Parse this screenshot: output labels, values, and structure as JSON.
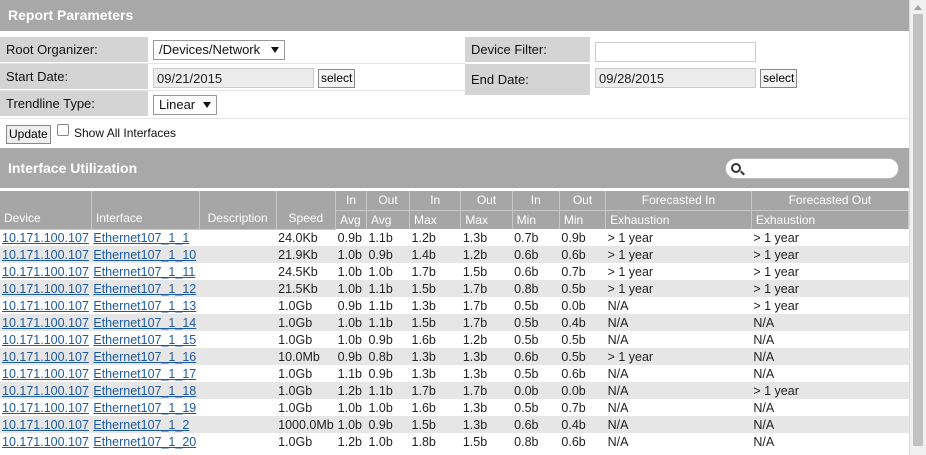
{
  "report_parameters": {
    "title": "Report Parameters",
    "root_organizer": {
      "label": "Root Organizer:",
      "value": "/Devices/Network"
    },
    "device_filter": {
      "label": "Device Filter:",
      "value": ""
    },
    "start_date": {
      "label": "Start Date:",
      "value": "09/21/2015",
      "select_label": "select"
    },
    "end_date": {
      "label": "End Date:",
      "value": "09/28/2015",
      "select_label": "select"
    },
    "trendline_type": {
      "label": "Trendline Type:",
      "value": "Linear"
    },
    "update_label": "Update",
    "show_all_label": "Show All Interfaces",
    "show_all_checked": false
  },
  "interface_utilization": {
    "title": "Interface Utilization",
    "search_value": "",
    "columns_top": [
      "Device",
      "Interface",
      "Description",
      "Speed",
      "In",
      "Out",
      "In",
      "Out",
      "In",
      "Out",
      "Forecasted In",
      "Forecasted Out"
    ],
    "columns_sub": [
      "Avg",
      "Avg",
      "Max",
      "Max",
      "Min",
      "Min",
      "Exhaustion",
      "Exhaustion"
    ],
    "rows": [
      [
        "10.171.100.107",
        "Ethernet107_1_1",
        "",
        "24.0Kb",
        "0.9b",
        "1.1b",
        "1.2b",
        "1.3b",
        "0.7b",
        "0.9b",
        "> 1 year",
        "> 1 year"
      ],
      [
        "10.171.100.107",
        "Ethernet107_1_10",
        "",
        "21.9Kb",
        "1.0b",
        "0.9b",
        "1.4b",
        "1.2b",
        "0.6b",
        "0.6b",
        "> 1 year",
        "> 1 year"
      ],
      [
        "10.171.100.107",
        "Ethernet107_1_11",
        "",
        "24.5Kb",
        "1.0b",
        "1.0b",
        "1.7b",
        "1.5b",
        "0.6b",
        "0.7b",
        "> 1 year",
        "> 1 year"
      ],
      [
        "10.171.100.107",
        "Ethernet107_1_12",
        "",
        "21.5Kb",
        "1.0b",
        "1.1b",
        "1.5b",
        "1.7b",
        "0.8b",
        "0.5b",
        "> 1 year",
        "> 1 year"
      ],
      [
        "10.171.100.107",
        "Ethernet107_1_13",
        "",
        "1.0Gb",
        "0.9b",
        "1.1b",
        "1.3b",
        "1.7b",
        "0.5b",
        "0.0b",
        "N/A",
        "> 1 year"
      ],
      [
        "10.171.100.107",
        "Ethernet107_1_14",
        "",
        "1.0Gb",
        "1.0b",
        "1.1b",
        "1.5b",
        "1.7b",
        "0.5b",
        "0.4b",
        "N/A",
        "N/A"
      ],
      [
        "10.171.100.107",
        "Ethernet107_1_15",
        "",
        "1.0Gb",
        "1.0b",
        "0.9b",
        "1.6b",
        "1.2b",
        "0.5b",
        "0.5b",
        "N/A",
        "N/A"
      ],
      [
        "10.171.100.107",
        "Ethernet107_1_16",
        "",
        "10.0Mb",
        "0.9b",
        "0.8b",
        "1.3b",
        "1.3b",
        "0.6b",
        "0.5b",
        "> 1 year",
        "N/A"
      ],
      [
        "10.171.100.107",
        "Ethernet107_1_17",
        "",
        "1.0Gb",
        "1.1b",
        "0.9b",
        "1.3b",
        "1.3b",
        "0.5b",
        "0.6b",
        "N/A",
        "N/A"
      ],
      [
        "10.171.100.107",
        "Ethernet107_1_18",
        "",
        "1.0Gb",
        "1.2b",
        "1.1b",
        "1.7b",
        "1.7b",
        "0.0b",
        "0.0b",
        "N/A",
        "> 1 year"
      ],
      [
        "10.171.100.107",
        "Ethernet107_1_19",
        "",
        "1.0Gb",
        "1.0b",
        "1.0b",
        "1.6b",
        "1.3b",
        "0.5b",
        "0.7b",
        "N/A",
        "N/A"
      ],
      [
        "10.171.100.107",
        "Ethernet107_1_2",
        "",
        "1000.0Mb",
        "1.0b",
        "0.9b",
        "1.5b",
        "1.3b",
        "0.6b",
        "0.4b",
        "N/A",
        "N/A"
      ],
      [
        "10.171.100.107",
        "Ethernet107_1_20",
        "",
        "1.0Gb",
        "1.2b",
        "1.0b",
        "1.8b",
        "1.5b",
        "0.8b",
        "0.6b",
        "N/A",
        "N/A"
      ]
    ]
  },
  "icons": {
    "search": "search-icon",
    "dropdown": "chevron-down-icon",
    "scroll": "scroll-up-icon"
  }
}
